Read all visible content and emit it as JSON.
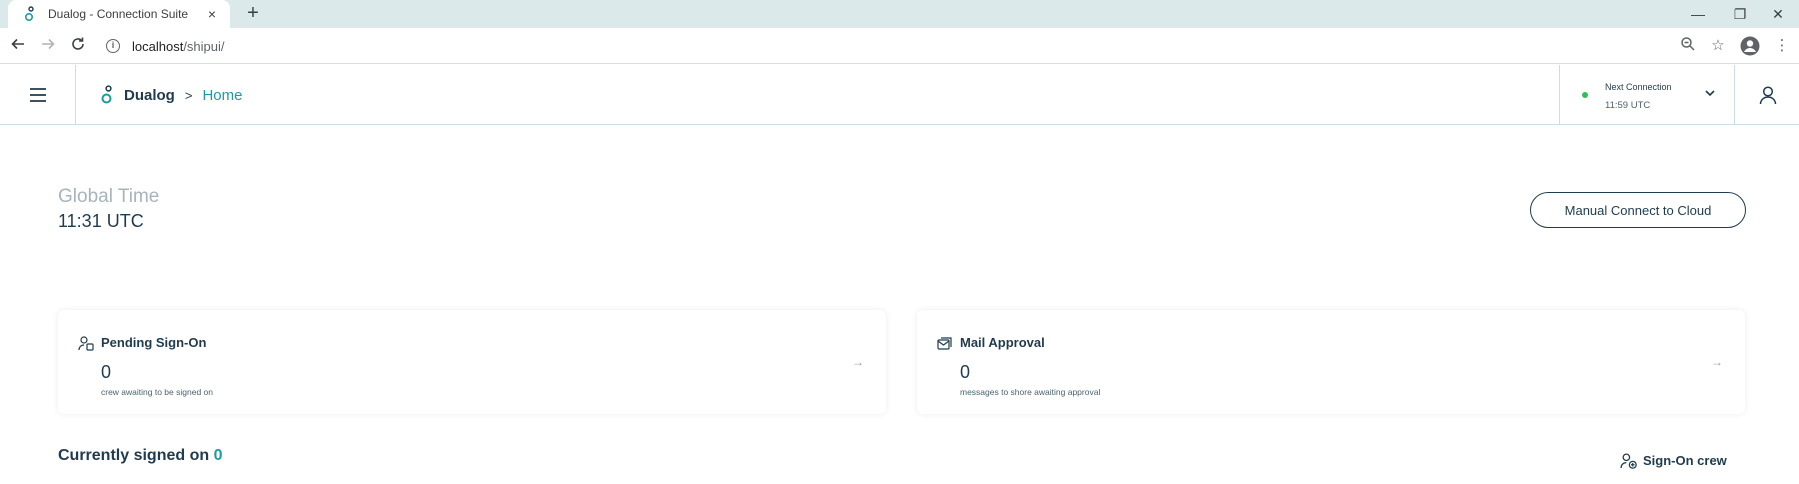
{
  "browser": {
    "tab_title": "Dualog - Connection Suite",
    "tab_close": "×",
    "new_tab": "+",
    "url_host": "localhost",
    "url_path": "/shipui/"
  },
  "header": {
    "brand": "Dualog",
    "separator": ">",
    "page": "Home",
    "next_connection_label": "Next Connection",
    "next_connection_time": "11:59 UTC",
    "status_color": "#2fbf55"
  },
  "main": {
    "global_time_label": "Global Time",
    "global_time_value": "11:31 UTC",
    "manual_connect_label": "Manual Connect to Cloud",
    "cards": [
      {
        "title": "Pending Sign-On",
        "value": "0",
        "subtitle": "crew awaiting to be signed on",
        "arrow": "→"
      },
      {
        "title": "Mail Approval",
        "value": "0",
        "subtitle": "messages to shore awaiting approval",
        "arrow": "→"
      }
    ],
    "currently_signed_label": "Currently signed on",
    "currently_signed_count": "0",
    "sign_on_crew_label": "Sign-On crew"
  },
  "colors": {
    "primary": "#1f3b4d",
    "accent": "#1f9aa1"
  }
}
